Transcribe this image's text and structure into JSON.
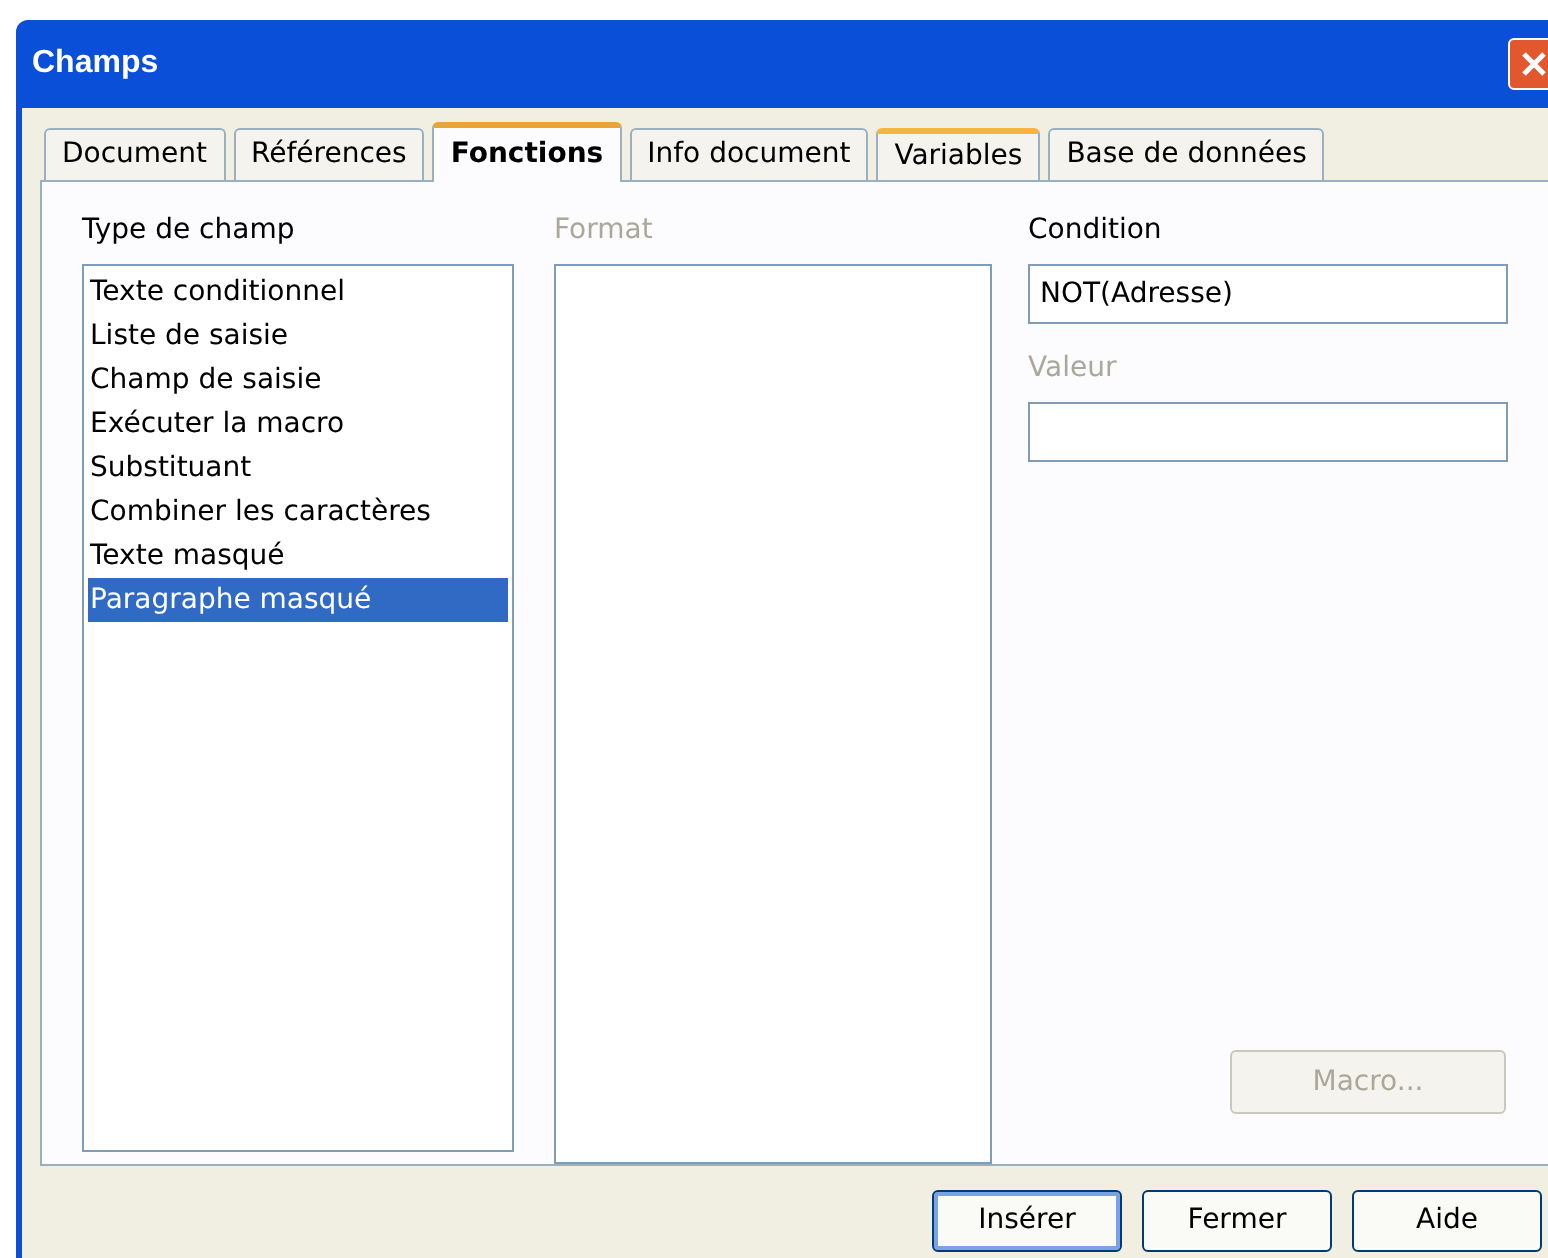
{
  "window": {
    "title": "Champs"
  },
  "tabs": [
    {
      "label": "Document",
      "selected": false,
      "hover": false
    },
    {
      "label": "Références",
      "selected": false,
      "hover": false
    },
    {
      "label": "Fonctions",
      "selected": true,
      "hover": false
    },
    {
      "label": "Info document",
      "selected": false,
      "hover": false
    },
    {
      "label": "Variables",
      "selected": false,
      "hover": true
    },
    {
      "label": "Base de données",
      "selected": false,
      "hover": false
    }
  ],
  "type_list": {
    "label": "Type de champ",
    "disabled": false,
    "items": [
      {
        "label": "Texte conditionnel",
        "selected": false
      },
      {
        "label": "Liste de saisie",
        "selected": false
      },
      {
        "label": "Champ de saisie",
        "selected": false
      },
      {
        "label": "Exécuter la macro",
        "selected": false
      },
      {
        "label": "Substituant",
        "selected": false
      },
      {
        "label": "Combiner les caractères",
        "selected": false
      },
      {
        "label": "Texte masqué",
        "selected": false
      },
      {
        "label": "Paragraphe masqué",
        "selected": true
      }
    ]
  },
  "format_list": {
    "label": "Format",
    "disabled": true
  },
  "condition": {
    "label": "Condition",
    "disabled": false,
    "value": "NOT(Adresse)"
  },
  "valeur": {
    "label": "Valeur",
    "disabled": true
  },
  "macro_button": {
    "label": "Macro...",
    "disabled": true
  },
  "buttons": [
    {
      "label": "Insérer",
      "default": true
    },
    {
      "label": "Fermer",
      "default": false
    },
    {
      "label": "Aide",
      "default": false
    }
  ]
}
